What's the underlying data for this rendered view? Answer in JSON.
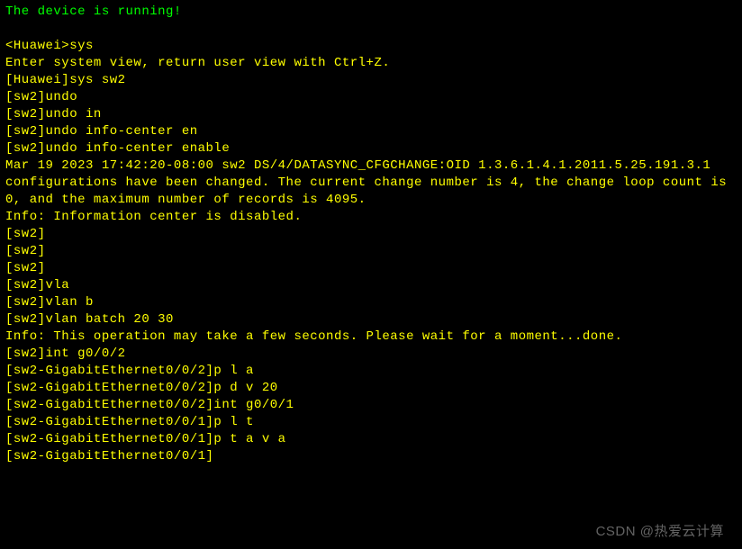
{
  "lines": [
    {
      "cls": "green",
      "text": "The device is running!"
    },
    {
      "cls": "",
      "text": " "
    },
    {
      "cls": "",
      "text": "<Huawei>sys"
    },
    {
      "cls": "",
      "text": "Enter system view, return user view with Ctrl+Z."
    },
    {
      "cls": "",
      "text": "[Huawei]sys sw2"
    },
    {
      "cls": "",
      "text": "[sw2]undo"
    },
    {
      "cls": "",
      "text": "[sw2]undo in"
    },
    {
      "cls": "",
      "text": "[sw2]undo info-center en"
    },
    {
      "cls": "",
      "text": "[sw2]undo info-center enable"
    },
    {
      "cls": "",
      "text": "Mar 19 2023 17:42:20-08:00 sw2 DS/4/DATASYNC_CFGCHANGE:OID 1.3.6.1.4.1.2011.5.25.191.3.1 configurations have been changed. The current change number is 4, the change loop count is 0, and the maximum number of records is 4095."
    },
    {
      "cls": "",
      "text": "Info: Information center is disabled."
    },
    {
      "cls": "",
      "text": "[sw2]"
    },
    {
      "cls": "",
      "text": "[sw2]"
    },
    {
      "cls": "",
      "text": "[sw2]"
    },
    {
      "cls": "",
      "text": "[sw2]vla"
    },
    {
      "cls": "",
      "text": "[sw2]vlan b"
    },
    {
      "cls": "",
      "text": "[sw2]vlan batch 20 30"
    },
    {
      "cls": "",
      "text": "Info: This operation may take a few seconds. Please wait for a moment...done."
    },
    {
      "cls": "",
      "text": "[sw2]int g0/0/2"
    },
    {
      "cls": "",
      "text": "[sw2-GigabitEthernet0/0/2]p l a"
    },
    {
      "cls": "",
      "text": "[sw2-GigabitEthernet0/0/2]p d v 20"
    },
    {
      "cls": "",
      "text": "[sw2-GigabitEthernet0/0/2]int g0/0/1"
    },
    {
      "cls": "",
      "text": "[sw2-GigabitEthernet0/0/1]p l t"
    },
    {
      "cls": "",
      "text": "[sw2-GigabitEthernet0/0/1]p t a v a"
    },
    {
      "cls": "",
      "text": "[sw2-GigabitEthernet0/0/1]"
    }
  ],
  "watermark": "CSDN @热爱云计算"
}
